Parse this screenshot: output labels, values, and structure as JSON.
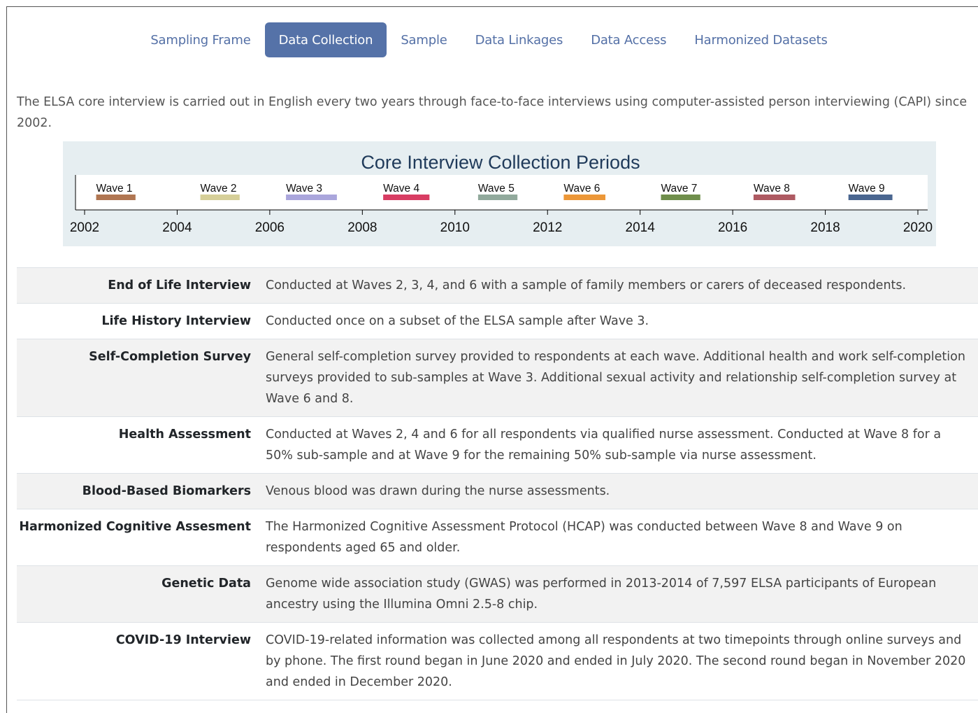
{
  "tabs": [
    {
      "label": "Sampling Frame",
      "active": false
    },
    {
      "label": "Data Collection",
      "active": true
    },
    {
      "label": "Sample",
      "active": false
    },
    {
      "label": "Data Linkages",
      "active": false
    },
    {
      "label": "Data Access",
      "active": false
    },
    {
      "label": "Harmonized Datasets",
      "active": false
    }
  ],
  "intro": "The ELSA core interview is carried out in English every two years through face-to-face interviews using computer-assisted person interviewing (CAPI) since 2002.",
  "chart_data": {
    "type": "timeline",
    "title": "Core Interview Collection Periods",
    "xlim": [
      2002,
      2020
    ],
    "ticks": [
      2002,
      2004,
      2006,
      2008,
      2010,
      2012,
      2014,
      2016,
      2018,
      2020
    ],
    "background": "#e6eef1",
    "series": [
      {
        "name": "Wave 1",
        "start": 2002.25,
        "end": 2003.1,
        "color": "#b07652"
      },
      {
        "name": "Wave 2",
        "start": 2004.5,
        "end": 2005.35,
        "color": "#d6cf98"
      },
      {
        "name": "Wave 3",
        "start": 2006.35,
        "end": 2007.45,
        "color": "#aaa6dc"
      },
      {
        "name": "Wave 4",
        "start": 2008.45,
        "end": 2009.45,
        "color": "#d83d63"
      },
      {
        "name": "Wave 5",
        "start": 2010.5,
        "end": 2011.35,
        "color": "#91a99c"
      },
      {
        "name": "Wave 6",
        "start": 2012.35,
        "end": 2013.25,
        "color": "#ec9738"
      },
      {
        "name": "Wave 7",
        "start": 2014.45,
        "end": 2015.3,
        "color": "#6f8e4b"
      },
      {
        "name": "Wave 8",
        "start": 2016.45,
        "end": 2017.35,
        "color": "#ae5a62"
      },
      {
        "name": "Wave 9",
        "start": 2018.5,
        "end": 2019.45,
        "color": "#4a6690"
      }
    ]
  },
  "rows": [
    {
      "label": "End of Life Interview",
      "desc": "Conducted at Waves 2, 3, 4, and 6 with a sample of family members or carers of deceased respondents."
    },
    {
      "label": "Life History Interview",
      "desc": "Conducted once on a subset of the ELSA sample after Wave 3."
    },
    {
      "label": "Self-Completion Survey",
      "desc": "General self-completion survey provided to respondents at each wave. Additional health and work self-completion surveys provided to sub-samples at Wave 3. Additional sexual activity and relationship self-completion survey at Wave 6 and 8."
    },
    {
      "label": "Health Assessment",
      "desc": "Conducted at Waves 2, 4 and 6 for all respondents via qualified nurse assessment. Conducted at Wave 8 for a 50% sub-sample and at Wave 9 for the remaining 50% sub-sample via nurse assessment."
    },
    {
      "label": "Blood-Based Biomarkers",
      "desc": "Venous blood was drawn during the nurse assessments."
    },
    {
      "label": "Harmonized Cognitive Assesment",
      "desc": "The Harmonized Cognitive Assessment Protocol (HCAP) was conducted between Wave 8 and Wave 9 on respondents aged 65 and older."
    },
    {
      "label": "Genetic Data",
      "desc": "Genome wide association study (GWAS) was performed in 2013-2014 of 7,597 ELSA participants of European ancestry using the Illumina Omni 2.5-8 chip."
    },
    {
      "label": "COVID-19 Interview",
      "desc": "COVID-19-related information was collected among all respondents at two timepoints through online surveys and by phone. The first round began in June 2020 and ended in July 2020. The second round began in November 2020 and ended in December 2020."
    }
  ]
}
